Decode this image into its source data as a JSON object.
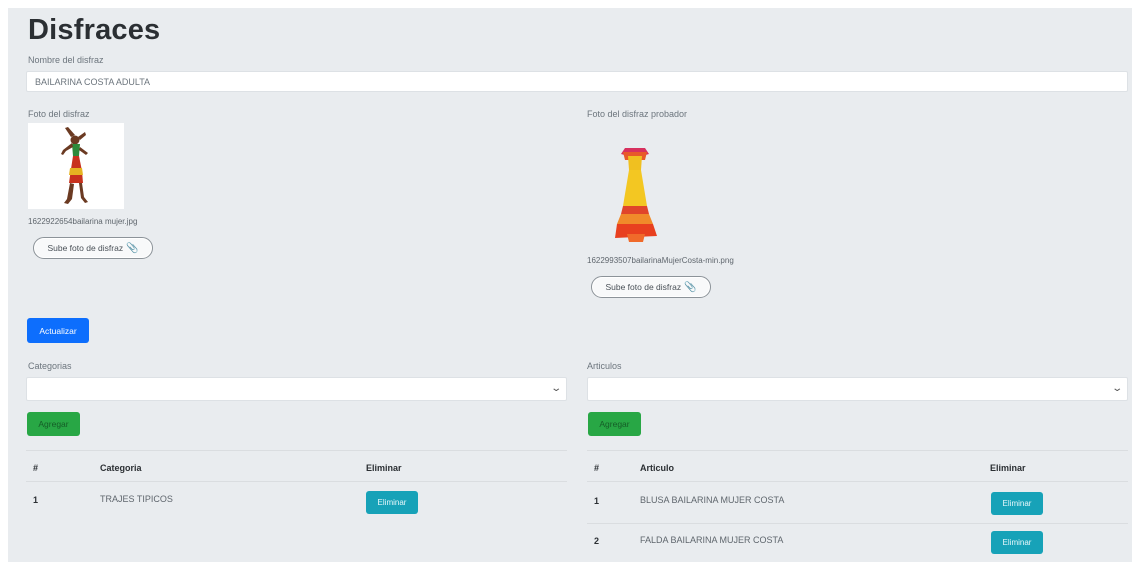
{
  "page": {
    "title": "Disfraces"
  },
  "form": {
    "name_label": "Nombre del disfraz",
    "name_value": "BAILARINA COSTA ADULTA",
    "photo_label": "Foto del disfraz",
    "photo_filename": "1622922654bailarina mujer.jpg",
    "photo_upload_label": "Sube foto de disfraz",
    "tester_label": "Foto del disfraz probador",
    "tester_filename": "1622993507bailarinaMujerCosta-min.png",
    "tester_upload_label": "Sube foto de disfraz",
    "update_label": "Actualizar"
  },
  "categories": {
    "label": "Categorias",
    "add_label": "Agregar",
    "columns": [
      "#",
      "Categoria",
      "Eliminar"
    ],
    "rows": [
      {
        "num": "1",
        "name": "TRAJES TIPICOS",
        "action": "Eliminar"
      }
    ]
  },
  "articles": {
    "label": "Articulos",
    "add_label": "Agregar",
    "columns": [
      "#",
      "Articulo",
      "Eliminar"
    ],
    "rows": [
      {
        "num": "1",
        "name": "BLUSA BAILARINA MUJER COSTA",
        "action": "Eliminar"
      },
      {
        "num": "2",
        "name": "FALDA BAILARINA MUJER COSTA",
        "action": "Eliminar"
      }
    ]
  },
  "icons": {
    "upload": "paperclip-icon",
    "select": "chevron-down-icon"
  },
  "colors": {
    "primary": "#0d6efd",
    "success": "#28a745",
    "info": "#17a2b8",
    "background": "#e9ecef"
  }
}
